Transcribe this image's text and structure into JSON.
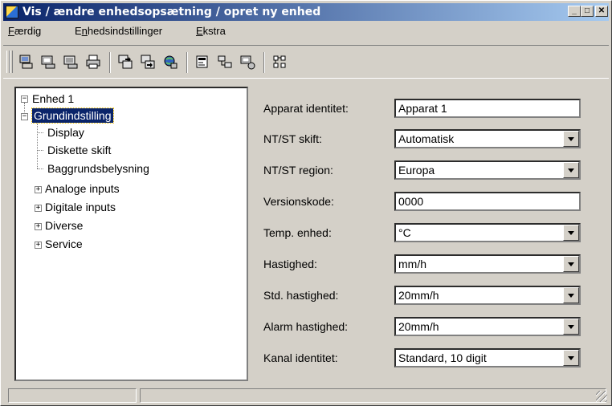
{
  "window": {
    "title": "Vis / ændre enhedsopsætning / opret ny enhed"
  },
  "menu": [
    {
      "pre": "",
      "u": "F",
      "post": "ærdig"
    },
    {
      "pre": "E",
      "u": "n",
      "post": "hedsindstillinger"
    },
    {
      "pre": "",
      "u": "E",
      "post": "kstra"
    }
  ],
  "tree": {
    "root": "Enhed 1",
    "selected": "Grundindstilling",
    "children_of_selected": [
      "Display",
      "Diskette skift",
      "Baggrundsbelysning"
    ],
    "collapsed": [
      "Analoge inputs",
      "Digitale inputs",
      "Diverse",
      "Service"
    ]
  },
  "properties": [
    {
      "label": "Apparat identitet:",
      "value": "Apparat 1",
      "type": "input"
    },
    {
      "label": "NT/ST skift:",
      "value": "Automatisk",
      "type": "select"
    },
    {
      "label": "NT/ST region:",
      "value": "Europa",
      "type": "select"
    },
    {
      "label": "Versionskode:",
      "value": "0000",
      "type": "input"
    },
    {
      "label": "Temp. enhed:",
      "value": "°C",
      "type": "select"
    },
    {
      "label": "Hastighed:",
      "value": "mm/h",
      "type": "select"
    },
    {
      "label": "Std. hastighed:",
      "value": "20mm/h",
      "type": "select"
    },
    {
      "label": "Alarm hastighed:",
      "value": "20mm/h",
      "type": "select"
    },
    {
      "label": "Kanal identitet:",
      "value": "Standard, 10 digit",
      "type": "select"
    }
  ],
  "colors": {
    "titlebar_start": "#0a246a",
    "titlebar_end": "#a6caf0",
    "face": "#d4d0c8",
    "selection": "#0a246a"
  }
}
